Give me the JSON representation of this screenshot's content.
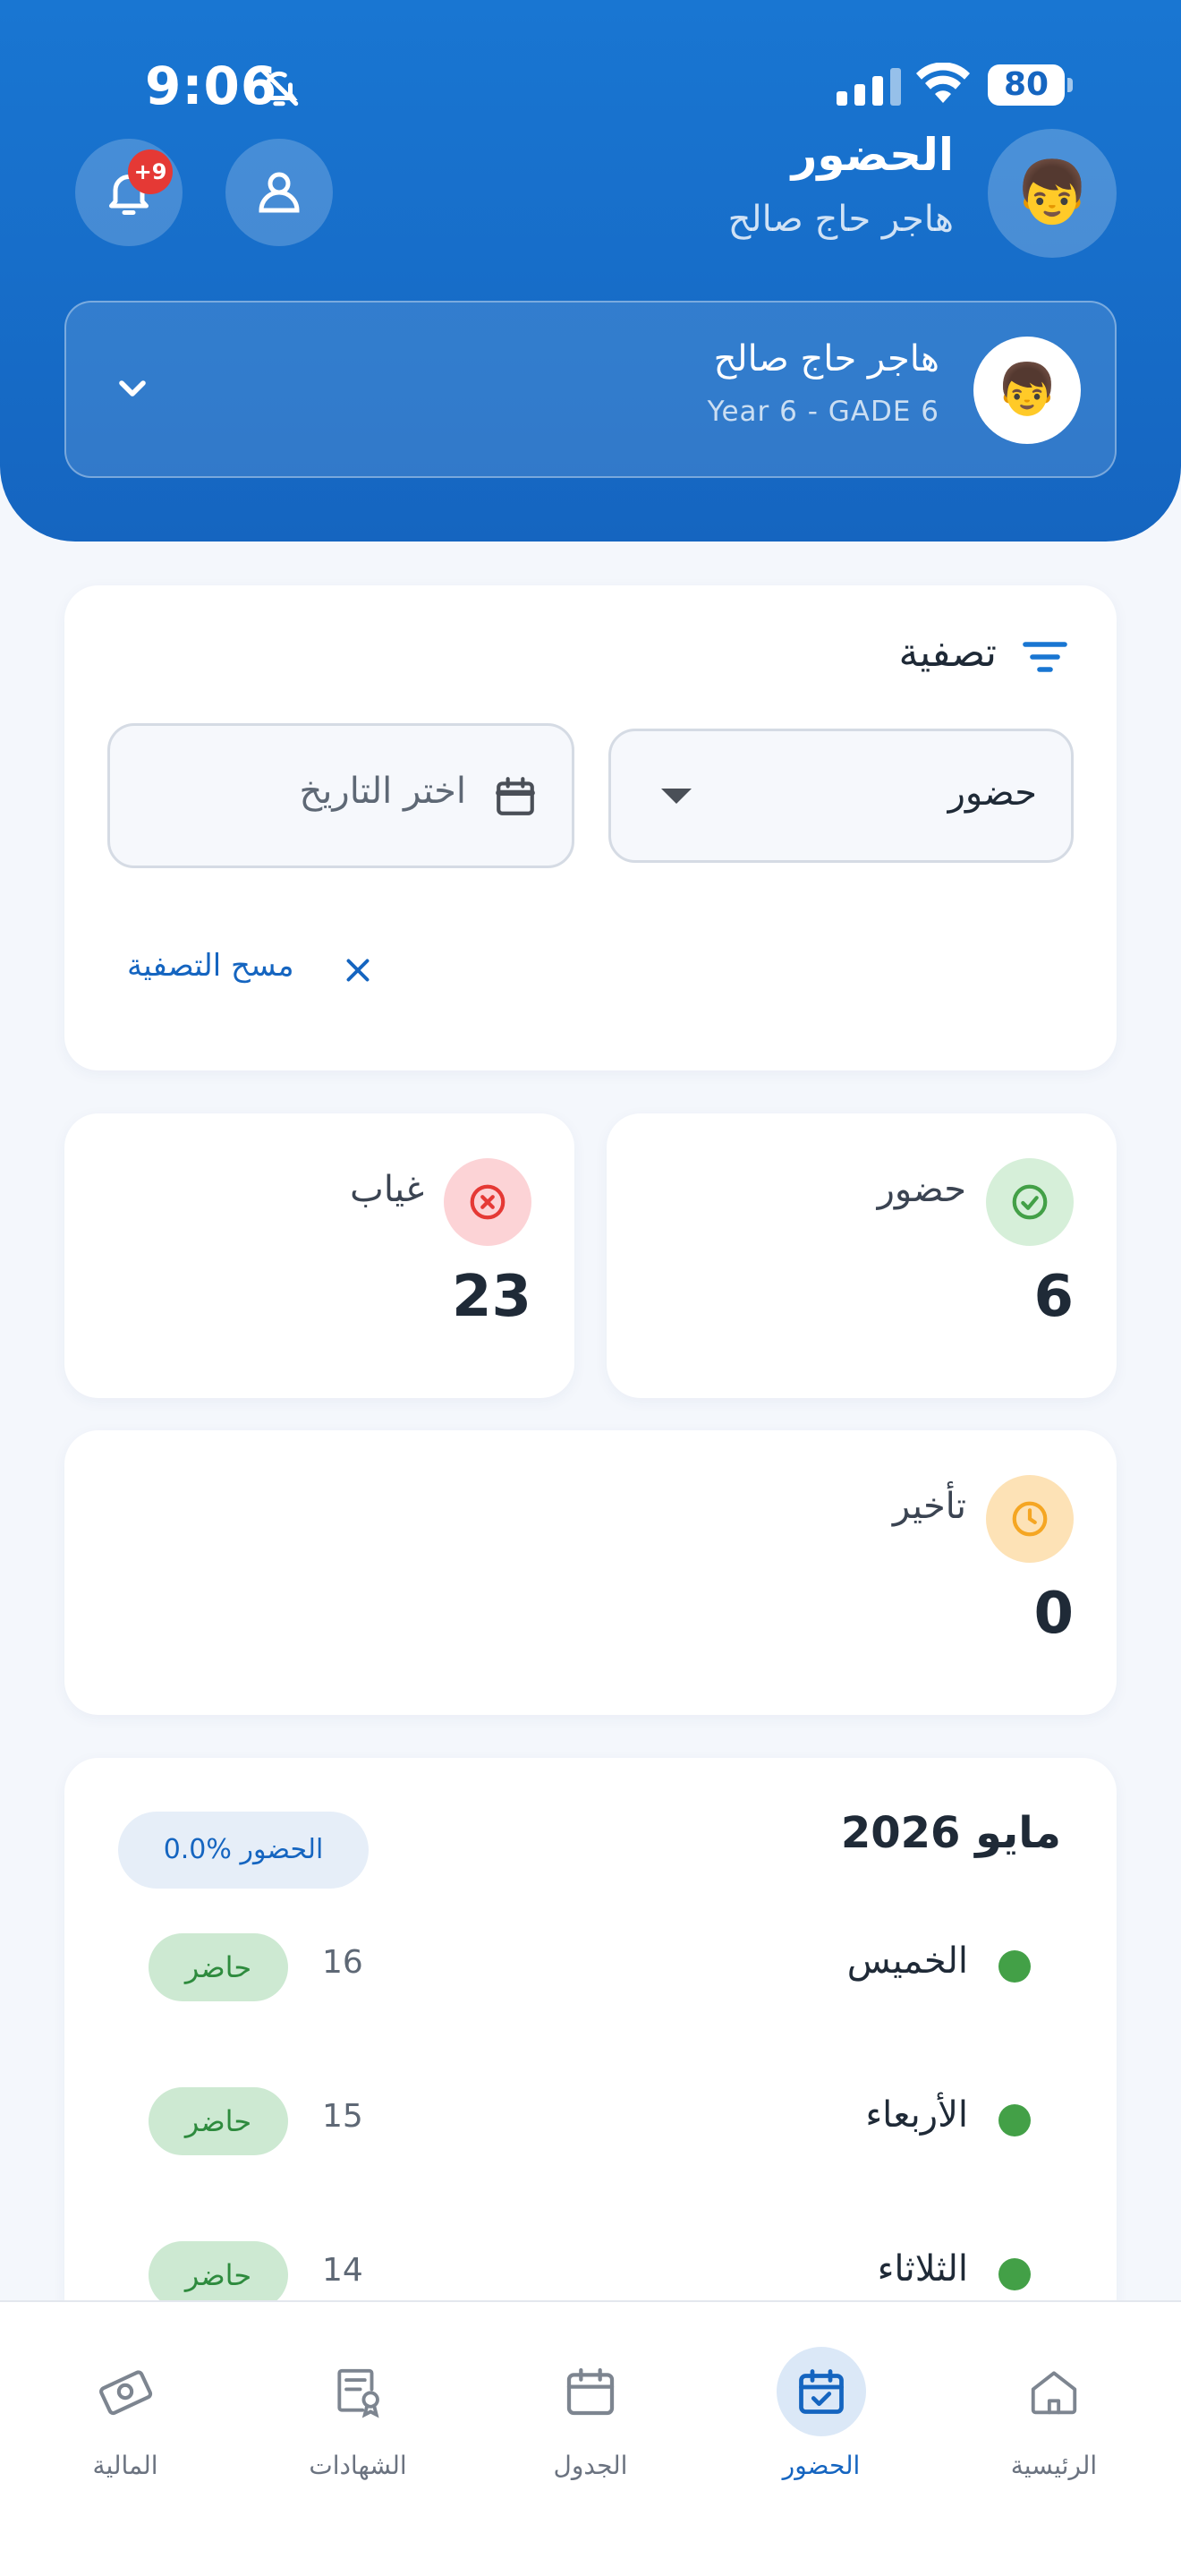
{
  "status_bar": {
    "time": "9:06",
    "battery": "80"
  },
  "header": {
    "title": "الحضور",
    "subtitle": "هاجر حاج صالح",
    "notification_badge": "+9",
    "avatar_emoji": "👦"
  },
  "student": {
    "name": "هاجر حاج صالح",
    "grade": "Year 6 - GADE 6",
    "avatar_emoji": "👦"
  },
  "filter": {
    "title": "تصفية",
    "type_value": "حضور",
    "date_placeholder": "اختر التاريخ",
    "clear_label": "مسح التصفية"
  },
  "stats": [
    {
      "label": "حضور",
      "value": "6",
      "color": "#43a047",
      "bg": "#d6efd9",
      "icon": "check-circle-icon"
    },
    {
      "label": "غياب",
      "value": "23",
      "color": "#e53935",
      "bg": "#fcd3d6",
      "icon": "x-circle-icon"
    },
    {
      "label": "تأخير",
      "value": "0",
      "color": "#f5a623",
      "bg": "#fde2b6",
      "icon": "clock-icon"
    }
  ],
  "month": {
    "title": "مايو 2026",
    "attendance_pct": "0.0% الحضور",
    "days": [
      {
        "name": "الخميس",
        "num": "16",
        "status": "حاضر"
      },
      {
        "name": "الأربعاء",
        "num": "15",
        "status": "حاضر"
      },
      {
        "name": "الثلاثاء",
        "num": "14",
        "status": "حاضر"
      }
    ]
  },
  "nav": [
    {
      "label": "المالية",
      "icon": "money-icon",
      "active": false
    },
    {
      "label": "الشهادات",
      "icon": "certificate-icon",
      "active": false
    },
    {
      "label": "الجدول",
      "icon": "calendar-icon",
      "active": false
    },
    {
      "label": "الحضور",
      "icon": "attendance-icon",
      "active": true
    },
    {
      "label": "الرئيسية",
      "icon": "home-icon",
      "active": false
    }
  ],
  "colors": {
    "primary": "#1976d2",
    "present": "#43a047",
    "absent": "#e53935",
    "late": "#f5a623"
  }
}
